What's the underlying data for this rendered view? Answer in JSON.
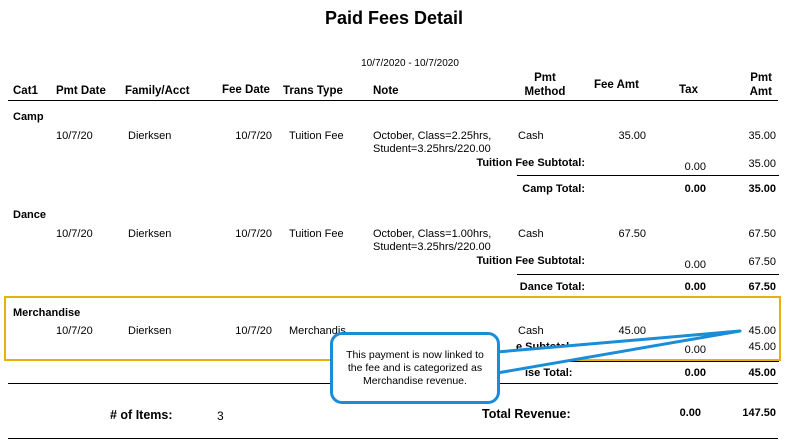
{
  "report": {
    "title": "Paid Fees Detail",
    "date_range": "10/7/2020 - 10/7/2020"
  },
  "columns": {
    "cat1": "Cat1",
    "pmt_date": "Pmt Date",
    "family": "Family/Acct",
    "fee_date": "Fee Date",
    "trans_type": "Trans Type",
    "note": "Note",
    "pmt_method_1": "Pmt",
    "pmt_method_2": "Method",
    "fee_amt": "Fee Amt",
    "tax": "Tax",
    "pmt_amt_1": "Pmt",
    "pmt_amt_2": "Amt"
  },
  "groups": [
    {
      "category": "Camp",
      "row": {
        "pmt_date": "10/7/20",
        "family": "Dierksen",
        "fee_date": "10/7/20",
        "trans_type": "Tuition Fee",
        "note_1": "October, Class=2.25hrs,",
        "note_2": "Student=3.25hrs/220.00",
        "pmt_method": "Cash",
        "fee_amt": "35.00",
        "tax": "",
        "pmt_amt": "35.00"
      },
      "subtotal": {
        "label": "Tuition Fee Subtotal:",
        "tax": "0.00",
        "pmt_amt": "35.00"
      },
      "total": {
        "label": "Camp Total:",
        "tax": "0.00",
        "pmt_amt": "35.00"
      }
    },
    {
      "category": "Dance",
      "row": {
        "pmt_date": "10/7/20",
        "family": "Dierksen",
        "fee_date": "10/7/20",
        "trans_type": "Tuition Fee",
        "note_1": "October, Class=1.00hrs,",
        "note_2": "Student=3.25hrs/220.00",
        "pmt_method": "Cash",
        "fee_amt": "67.50",
        "tax": "",
        "pmt_amt": "67.50"
      },
      "subtotal": {
        "label": "Tuition Fee Subtotal:",
        "tax": "0.00",
        "pmt_amt": "67.50"
      },
      "total": {
        "label": "Dance Total:",
        "tax": "0.00",
        "pmt_amt": "67.50"
      }
    },
    {
      "category": "Merchandise",
      "row": {
        "pmt_date": "10/7/20",
        "family": "Dierksen",
        "fee_date": "10/7/20",
        "trans_type": "Merchandis",
        "pmt_method": "Cash",
        "fee_amt": "45.00",
        "tax": "",
        "pmt_amt": "45.00"
      },
      "subtotal": {
        "label_visible": "e Subtotal:",
        "tax": "0.00",
        "pmt_amt": "45.00"
      },
      "total": {
        "label_visible": "ise Total:",
        "tax": "0.00",
        "pmt_amt": "45.00"
      }
    }
  ],
  "summary": {
    "items_label": "# of Items:",
    "items_count": "3",
    "revenue_label": "Total Revenue:",
    "revenue_tax": "0.00",
    "revenue_amt": "147.50"
  },
  "callout": {
    "text": "This payment is now linked to the fee and is categorized as Merchandise revenue."
  },
  "colors": {
    "highlight_box": "#e8b00e",
    "callout_border": "#1a8cd8"
  }
}
